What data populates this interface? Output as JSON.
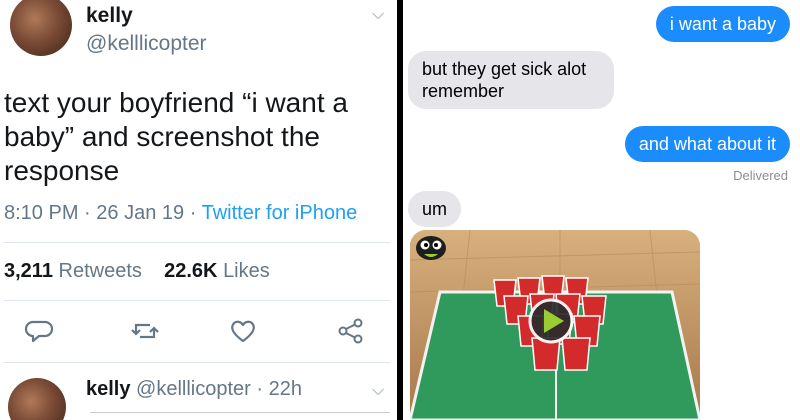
{
  "tweet": {
    "display_name": "kelly",
    "handle": "@kelllicopter",
    "text": "text your boyfriend “i want a baby” and screenshot the response",
    "time": "8:10 PM",
    "date": "26 Jan 19",
    "separator": "·",
    "source": "Twitter for iPhone",
    "retweets_count": "3,211",
    "retweets_label": "Retweets",
    "likes_count": "22.6K",
    "likes_label": "Likes",
    "icons": [
      "reply-icon",
      "retweet-icon",
      "like-icon",
      "share-icon",
      "chevron-down-icon"
    ]
  },
  "reply": {
    "display_name": "kelly",
    "handle": "@kelllicopter",
    "separator": "·",
    "age": "22h"
  },
  "chat": {
    "messages": [
      {
        "from": "me",
        "text": "i want a baby"
      },
      {
        "from": "them",
        "text": "but they get sick alot remember"
      },
      {
        "from": "me",
        "text": "and what about it"
      },
      {
        "from": "them",
        "text": "um"
      }
    ],
    "delivered_label": "Delivered",
    "attachment": {
      "type": "video",
      "icon": "play-icon"
    }
  },
  "colors": {
    "twitter_blue": "#1da1f2",
    "imessage_blue": "#1a8cfb",
    "bubble_gray": "#e5e5ea",
    "cup_red": "#d32b2b",
    "table_green": "#2f9a5c"
  }
}
